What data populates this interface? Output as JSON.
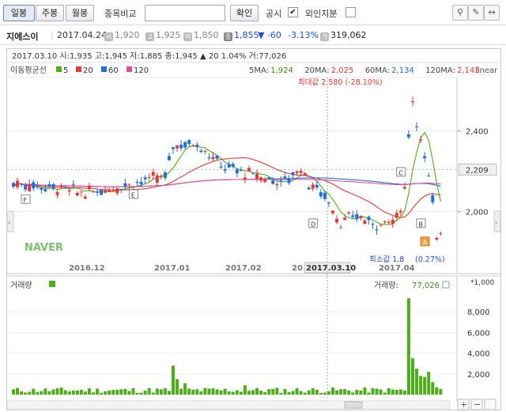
{
  "toolbar": {
    "daily": "일봉",
    "weekly": "주봉",
    "monthly": "월봉",
    "compare_label": "종목비교",
    "compare_value": "",
    "confirm": "확인",
    "disclosure": "공시",
    "disclosure_checked": true,
    "foreign": "외인지분",
    "foreign_checked": false,
    "tools": [
      "pin-icon",
      "pen-icon",
      "drag-icon",
      "trash-icon",
      "scale-icon"
    ]
  },
  "stock": {
    "name": "지에스이",
    "date": "2017.04.24",
    "open_badge": "시",
    "open": "1,920",
    "high_badge": "고",
    "high": "1,925",
    "low_badge": "저",
    "low": "1,850",
    "close_badge": "종",
    "close": "1,855",
    "change": "▼ -60",
    "change_pct": "-3.13%",
    "volume_badge": "거",
    "volume": "319,062"
  },
  "chart_header": {
    "line": "2017.03.10  시:1,935  고:1,945  저:1,885  종:1,945  ▲   20   1.04%  거:77,026",
    "scale": "linear",
    "ma_title": "이동평균선",
    "ma_legend": [
      {
        "label": "5",
        "color": "#4caf1a"
      },
      {
        "label": "20",
        "color": "#e53935"
      },
      {
        "label": "60",
        "color": "#1e6fd9"
      },
      {
        "label": "120",
        "color": "#e64aa0"
      }
    ],
    "ma_values": [
      {
        "label": "5MA:",
        "value": "1,924",
        "color": "#3a8d12"
      },
      {
        "label": "20MA:",
        "value": "2,025",
        "color": "#e53935"
      },
      {
        "label": "60MA:",
        "value": "2,134",
        "color": "#1e6fd9"
      },
      {
        "label": "120MA:",
        "value": "2,143",
        "color": "#e53935"
      }
    ],
    "max_label": "최대값 2,580 (-28.10%)",
    "min_label": "최소값 1,8",
    "min_pct": "(0.27%)",
    "watermark": "NAVER"
  },
  "chart_data": [
    {
      "type": "candlestick",
      "y_ticks": [
        "2,400",
        "2,000"
      ],
      "y_current": "2,209",
      "x_ticks": [
        "2016.12",
        "2017.01",
        "2017.02",
        "20",
        "2017.03.10",
        "2017.04"
      ],
      "markers": [
        "F",
        "E",
        "D",
        "C",
        "B",
        "A"
      ],
      "ma_series": [
        "5",
        "20",
        "60",
        "120"
      ],
      "ylim": [
        1700,
        2650
      ]
    },
    {
      "type": "bar",
      "title": "거래량",
      "value_label": "거래량:",
      "value": "77,026",
      "y_ticks": [
        "*1,000",
        "8,000",
        "6,000",
        "4,000",
        "2,000"
      ],
      "ylim": [
        0,
        10000
      ]
    }
  ],
  "scroll": {
    "plus": "+",
    "minus": "−"
  }
}
